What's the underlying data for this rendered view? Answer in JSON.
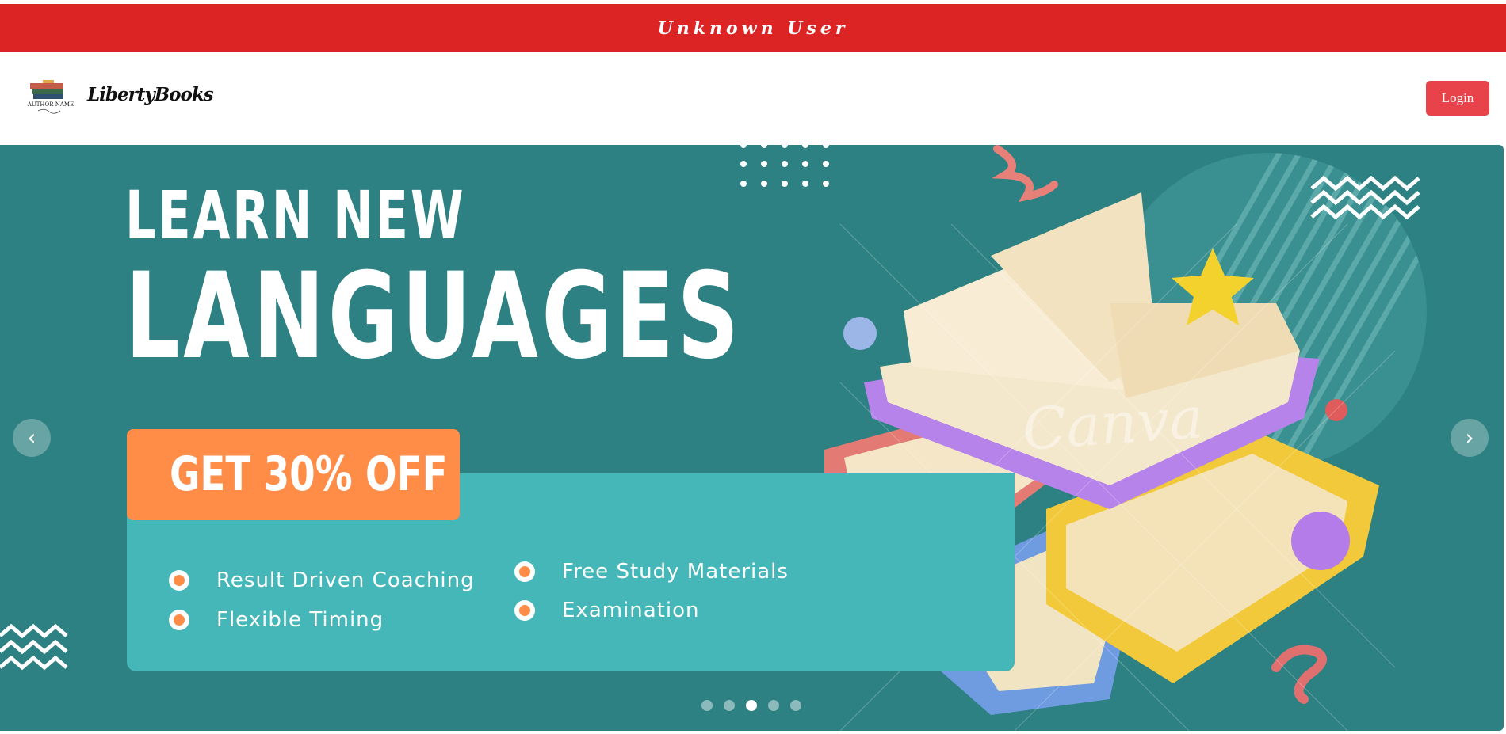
{
  "banner": {
    "text": "Unknown User"
  },
  "navbar": {
    "logo_caption": "AUTHOR NAME",
    "brand": "LibertyBooks",
    "login_label": "Login"
  },
  "hero": {
    "headline_small": "LEARN NEW",
    "headline_big": "LANGUAGES",
    "offer": "GET 30% OFF",
    "features": [
      "Result Driven Coaching",
      "Flexible Timing",
      "Free Study Materials",
      "Examination"
    ],
    "watermark": "Canva",
    "prev_glyph": "‹",
    "next_glyph": "›",
    "slide_count": 5,
    "active_slide": 3
  },
  "colors": {
    "banner": "#dd2424",
    "login": "#e8424a",
    "hero_bg": "#2e8182",
    "panel": "#46b7b9",
    "offer": "#ff8c47"
  }
}
